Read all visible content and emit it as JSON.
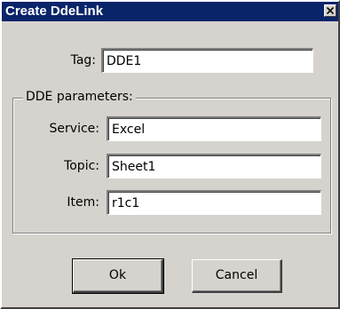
{
  "window": {
    "title": "Create DdeLink"
  },
  "tag": {
    "label": "Tag:",
    "value": "DDE1"
  },
  "dde_group": {
    "legend": "DDE parameters:",
    "service": {
      "label": "Service:",
      "value": "Excel"
    },
    "topic": {
      "label": "Topic:",
      "value": "Sheet1"
    },
    "item": {
      "label": "Item:",
      "value": "r1c1"
    }
  },
  "buttons": {
    "ok_label": "Ok",
    "cancel_label": "Cancel"
  },
  "icons": {
    "close": "close-icon"
  },
  "colors": {
    "titlebar": "#0a246a",
    "face": "#d6d3ce"
  }
}
